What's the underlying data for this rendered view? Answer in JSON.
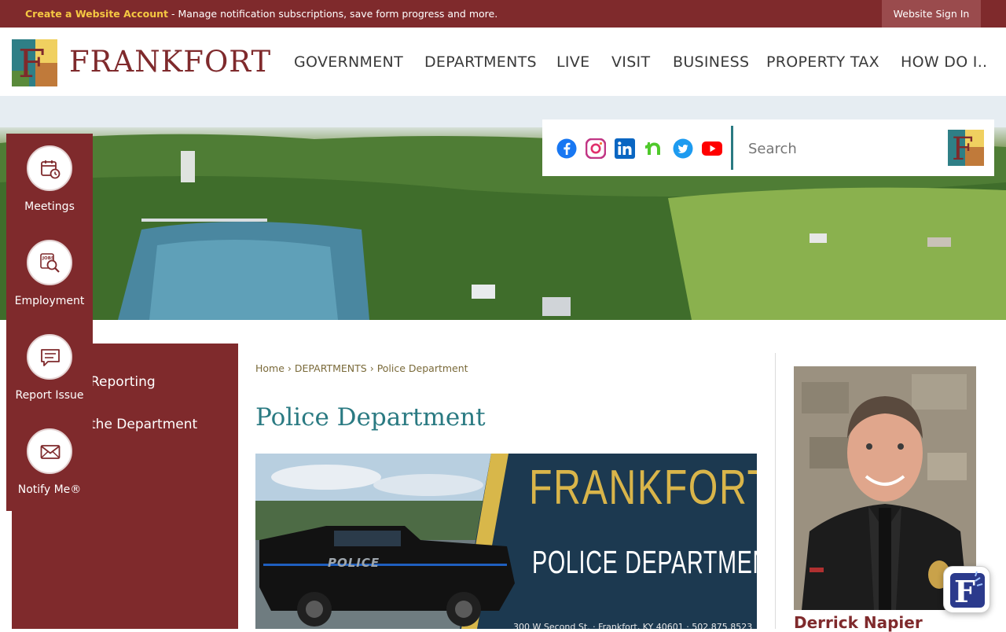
{
  "topbar": {
    "account_link": "Create a Website Account",
    "message": " - Manage notification subscriptions, save form progress and more.",
    "signin": "Website Sign In"
  },
  "header": {
    "logo_text": "FRANKFORT",
    "nav": [
      "GOVERNMENT",
      "DEPARTMENTS",
      "LIVE",
      "VISIT",
      "BUSINESS",
      "PROPERTY TAX",
      "HOW DO I.."
    ]
  },
  "social": {
    "icons": [
      "facebook-icon",
      "instagram-icon",
      "linkedin-icon",
      "nextdoor-icon",
      "twitter-icon",
      "youtube-icon"
    ],
    "search_placeholder": "Search"
  },
  "quicklinks": [
    {
      "label": "Meetings",
      "icon": "calendar-clock-icon"
    },
    {
      "label": "Employment",
      "icon": "jobs-search-icon"
    },
    {
      "label": "Report Issue",
      "icon": "chat-bubble-icon"
    },
    {
      "label": "Notify Me®",
      "icon": "envelope-icon"
    }
  ],
  "sidenav": {
    "items": [
      "Reporting",
      "the Department"
    ]
  },
  "breadcrumb": {
    "home": "Home",
    "sep": "›",
    "section": "DEPARTMENTS",
    "current": "Police Department"
  },
  "page": {
    "title": "Police Department"
  },
  "banner": {
    "line1": "FRANKFORT",
    "line2": "POLICE DEPARTMENT",
    "address": "300 W Second St. · Frankfort, KY 40601 · 502.875.8523",
    "truck_text": "POLICE"
  },
  "chief": {
    "name": "Derrick Napier"
  },
  "colors": {
    "brand": "#7f2a2c",
    "accent": "#2a7a82",
    "highlight": "#f5c842"
  }
}
